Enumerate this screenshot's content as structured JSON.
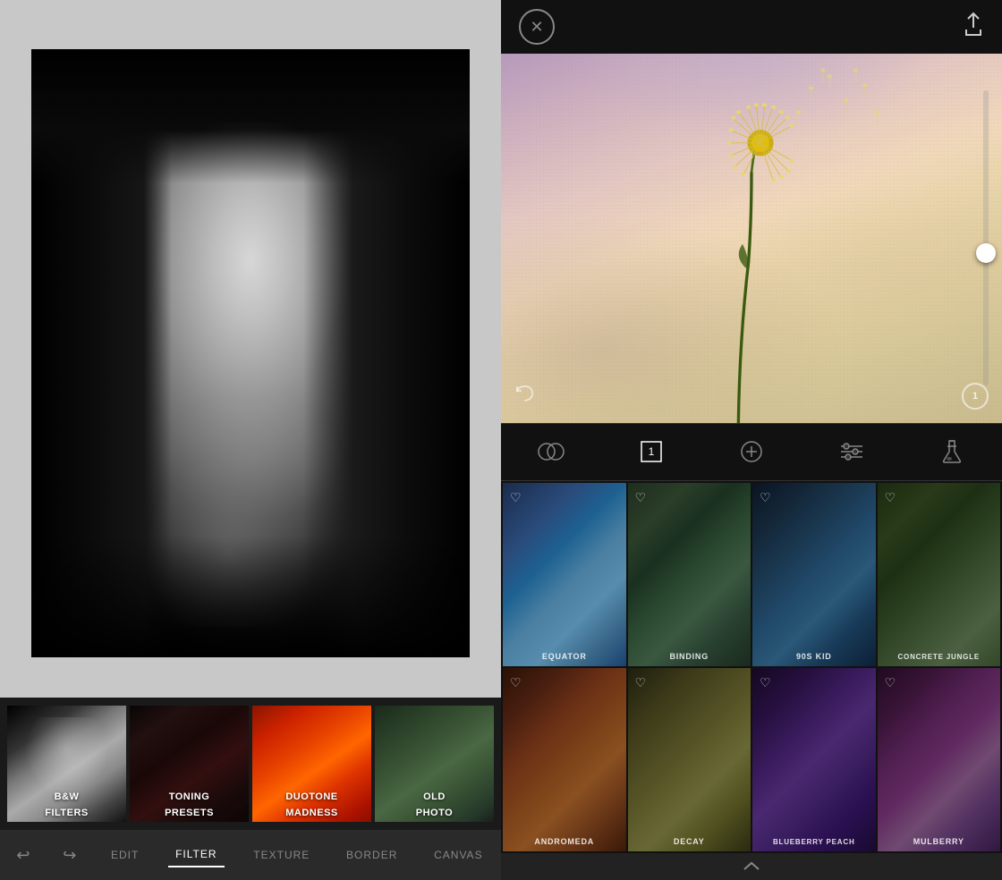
{
  "left": {
    "filters": [
      {
        "id": "bw",
        "label": "B&W\nFILTERS",
        "label_line1": "B&W",
        "label_line2": "FILTERS",
        "style": "bw"
      },
      {
        "id": "toning",
        "label": "TONING\nPRESETS",
        "label_line1": "TONING",
        "label_line2": "PRESETS",
        "style": "toning"
      },
      {
        "id": "duotone",
        "label": "DUOTONE\nMADNESS",
        "label_line1": "DUOTONE",
        "label_line2": "MADNESS",
        "style": "duotone"
      },
      {
        "id": "oldphoto",
        "label": "OLD\nPHOTO",
        "label_line1": "OLD",
        "label_line2": "PHOTO",
        "style": "oldphoto"
      }
    ],
    "toolbar": {
      "undo_icon": "↩",
      "redo_icon": "↪",
      "tabs": [
        "EDIT",
        "FILTER",
        "TEXTURE",
        "BORDER",
        "CANVAS"
      ]
    },
    "active_tab": "FILTER"
  },
  "right": {
    "close_label": "✕",
    "share_icon": "↑",
    "slider_value": "55",
    "intensity_badge": "1",
    "undo_icon": "↺",
    "middle_tools": [
      {
        "id": "blend",
        "icon": "⊕",
        "label": "blend",
        "active": false
      },
      {
        "id": "layers",
        "icon": "▣",
        "label": "layers",
        "active": false
      },
      {
        "id": "add",
        "icon": "⊕",
        "label": "add",
        "active": false
      },
      {
        "id": "adjust",
        "icon": "≡",
        "label": "adjust",
        "active": false
      },
      {
        "id": "lab",
        "icon": "⚗",
        "label": "lab",
        "active": false
      }
    ],
    "textures": [
      {
        "id": "equator",
        "name": "EQUATOR",
        "style": "tex-equator"
      },
      {
        "id": "binding",
        "name": "BINDING",
        "style": "tex-binding"
      },
      {
        "id": "90skid",
        "name": "90S KID",
        "style": "tex-90skid"
      },
      {
        "id": "concrete",
        "name": "CONCRETE JUNGLE",
        "style": "tex-concrete"
      },
      {
        "id": "andromeda",
        "name": "ANDROMEDA",
        "style": "tex-andromeda"
      },
      {
        "id": "decay",
        "name": "DECAY",
        "style": "tex-decay"
      },
      {
        "id": "blueberry",
        "name": "BLUEBERRY PEACH",
        "style": "tex-blueberry"
      },
      {
        "id": "mulberry",
        "name": "MULBERRY",
        "style": "tex-mulberry"
      }
    ],
    "scroll_up_label": "^"
  }
}
